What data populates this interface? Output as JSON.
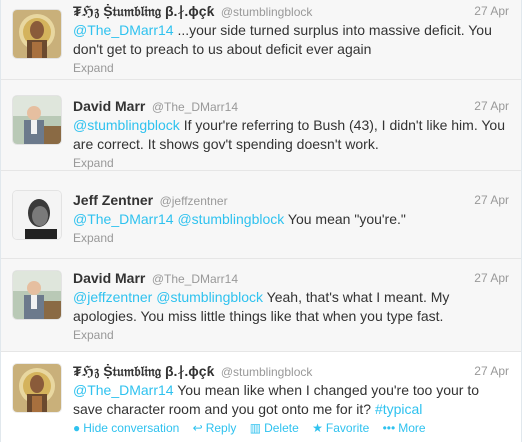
{
  "tweets": [
    {
      "fullname": "₮ℌ𝔷 Ṩ𝔱𝔲𝔪𝔟𝔩𝔦𝔫𝔤 β.∤.ϕçƙ",
      "screenname": "@stumblingblock",
      "time": "27 Apr",
      "mention": "@The_DMarr14",
      "text": " ...your side turned surplus into massive deficit. You don't get to preach to us about deficit ever again",
      "expand": "Expand"
    },
    {
      "fullname": "David Marr",
      "screenname": "@The_DMarr14",
      "time": "27 Apr",
      "mention": "@stumblingblock",
      "text": " If your're referring to Bush (43), I didn't like him. You are correct. It shows gov't spending doesn't work.",
      "expand": "Expand"
    },
    {
      "fullname": "Jeff Zentner",
      "screenname": "@jeffzentner",
      "time": "27 Apr",
      "mention1": "@The_DMarr14",
      "mention2": "@stumblingblock",
      "text": " You mean \"you're.\"",
      "expand": "Expand"
    },
    {
      "fullname": "David Marr",
      "screenname": "@The_DMarr14",
      "time": "27 Apr",
      "mention1": "@jeffzentner",
      "mention2": "@stumblingblock",
      "text": " Yeah, that's what I meant. My apologies. You miss little things like that when you type fast.",
      "expand": "Expand"
    },
    {
      "fullname": "₮ℌ𝔷 Ṩ𝔱𝔲𝔪𝔟𝔩𝔦𝔫𝔤 β.∤.ϕçƙ",
      "screenname": "@stumblingblock",
      "time": "27 Apr",
      "mention": "@The_DMarr14",
      "text": " You mean like when I changed you're too your to save character room and you got onto me for it? ",
      "hashtag": "#typical"
    }
  ],
  "actions": {
    "hide_conversation": "Hide conversation",
    "reply": "Reply",
    "delete": "Delete",
    "favorite": "Favorite",
    "more": "More"
  },
  "colors": {
    "link": "#2fc2ef",
    "muted": "#999999",
    "text": "#333333"
  },
  "icons": [
    "speech-bubble-icon",
    "reply-arrow-icon",
    "trash-icon",
    "star-icon",
    "more-dots-icon"
  ]
}
